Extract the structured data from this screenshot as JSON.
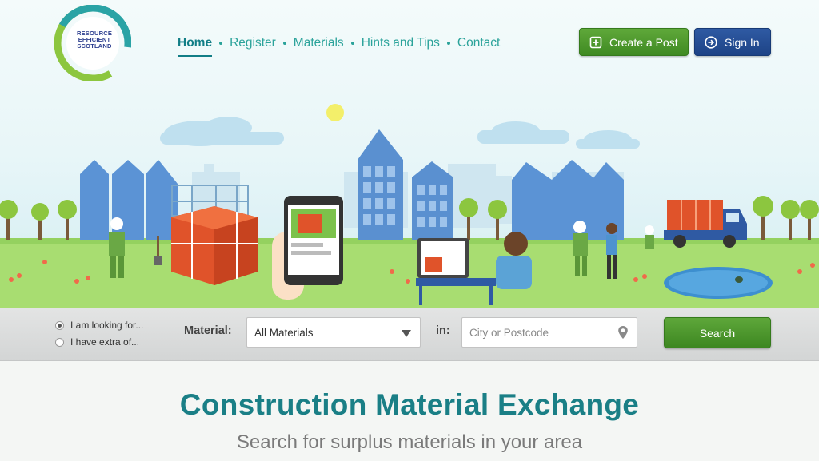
{
  "logo": {
    "text_line1": "RESOURCE",
    "text_line2": "EFFICIENT",
    "text_line3": "SCOTLAND"
  },
  "nav": [
    {
      "label": "Home",
      "active": true
    },
    {
      "label": "Register"
    },
    {
      "label": "Materials"
    },
    {
      "label": "Hints and Tips"
    },
    {
      "label": "Contact"
    }
  ],
  "header_buttons": {
    "create_post": "Create a Post",
    "sign_in": "Sign In"
  },
  "search": {
    "mode_options": [
      "I am looking for...",
      "I have extra of..."
    ],
    "selected_mode": "I am looking for...",
    "material_label": "Material:",
    "material_value": "All Materials",
    "in_label": "in:",
    "location_placeholder": "City or Postcode",
    "button_label": "Search"
  },
  "headline": {
    "title": "Construction Material Exchange",
    "subtitle": "Search for surplus materials in your area"
  },
  "colors": {
    "teal": "#1a7f86",
    "green_button": "#4e9a2d",
    "blue_button": "#244c94"
  },
  "icons": [
    "plus-square-icon",
    "arrow-circle-icon",
    "chevron-down-icon",
    "map-pin-icon"
  ]
}
